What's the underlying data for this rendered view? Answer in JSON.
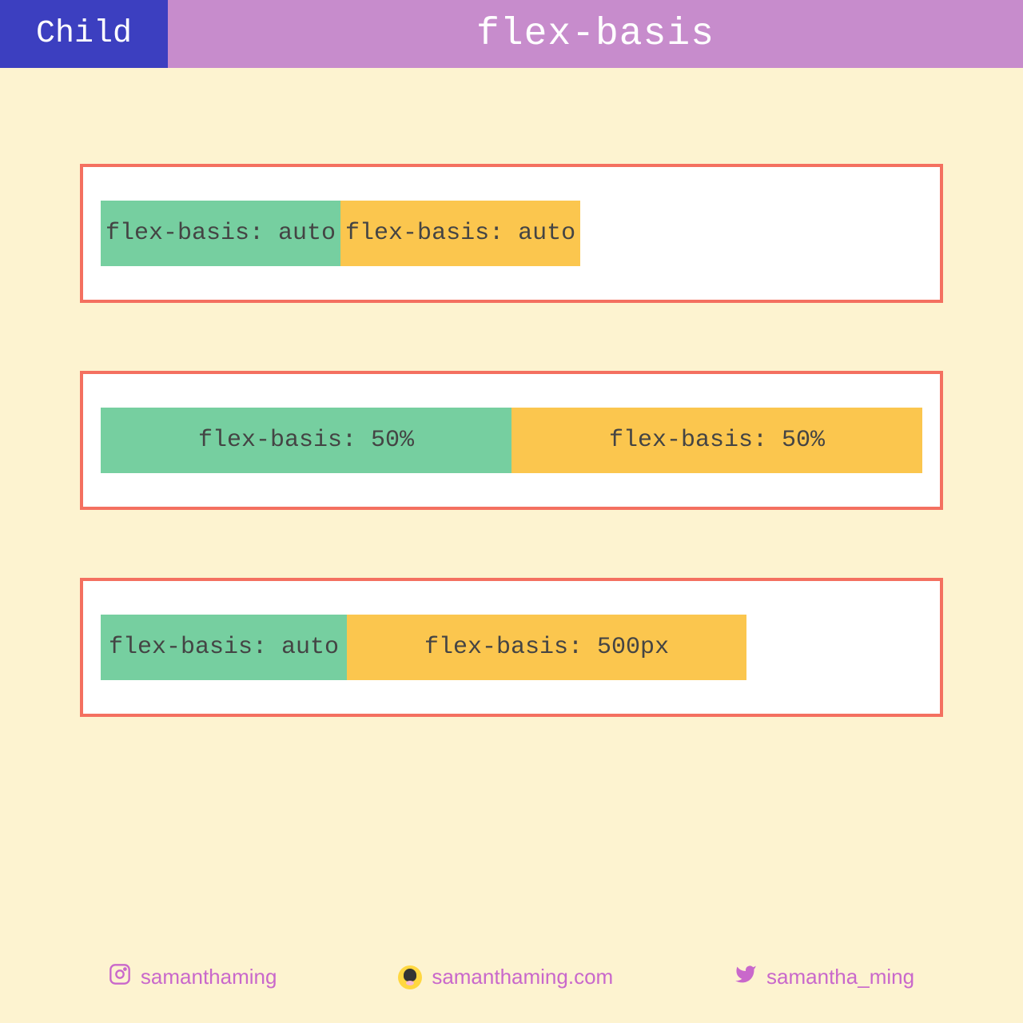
{
  "header": {
    "badge": "Child",
    "title": "flex-basis"
  },
  "examples": [
    {
      "item1": "flex-basis: auto",
      "item2": "flex-basis: auto"
    },
    {
      "item1": "flex-basis: 50%",
      "item2": "flex-basis: 50%"
    },
    {
      "item1": "flex-basis: auto",
      "item2": "flex-basis: 500px"
    }
  ],
  "footer": {
    "instagram": "samanthaming",
    "website": "samanthaming.com",
    "twitter": "samantha_ming"
  },
  "colors": {
    "badgeBg": "#3c3fc0",
    "titleBg": "#c78ccc",
    "pageBg": "#fdf3d0",
    "boxBorder": "#f47060",
    "green": "#76cfa0",
    "yellow": "#fbc64e",
    "social": "#c968cb"
  }
}
